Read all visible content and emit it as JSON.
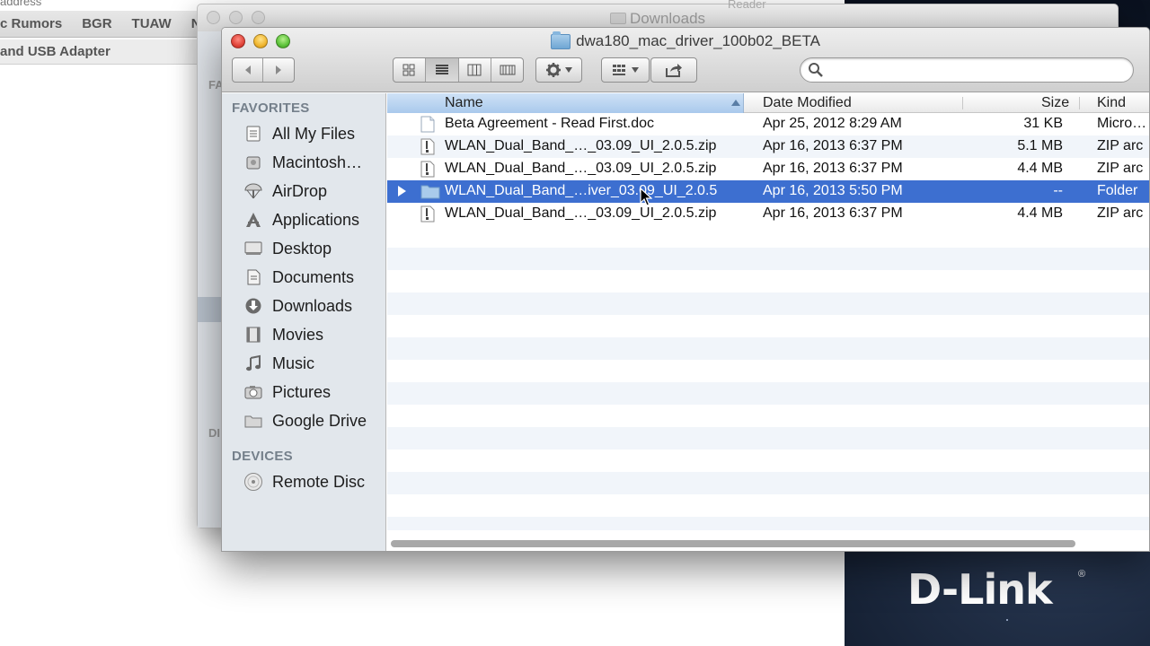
{
  "background_browser": {
    "address_fragment": "address",
    "bookmarks": [
      "c Rumors",
      "BGR",
      "TUAW",
      "N"
    ],
    "subtitle": "and USB Adapter",
    "strip_letters": [
      "FA",
      "DI"
    ]
  },
  "back_window": {
    "title": "Downloads",
    "behind_label": "Reader"
  },
  "window": {
    "title": "dwa180_mac_driver_100b02_BETA",
    "search": {
      "placeholder": "",
      "value": ""
    }
  },
  "toolbar": {
    "back_icon": "chevron-left-icon",
    "forward_icon": "chevron-right-icon",
    "view_modes": [
      "icon-view-icon",
      "list-view-icon",
      "column-view-icon",
      "coverflow-view-icon"
    ],
    "active_view": "list",
    "action_icon": "gear-icon",
    "arrange_icon": "grid-icon",
    "share_icon": "share-icon"
  },
  "sidebar": {
    "favorites_heading": "FAVORITES",
    "favorites": [
      {
        "label": "All My Files",
        "icon": "all-files-icon"
      },
      {
        "label": "Macintosh…",
        "icon": "hard-drive-icon"
      },
      {
        "label": "AirDrop",
        "icon": "airdrop-icon"
      },
      {
        "label": "Applications",
        "icon": "applications-icon"
      },
      {
        "label": "Desktop",
        "icon": "desktop-icon"
      },
      {
        "label": "Documents",
        "icon": "documents-icon"
      },
      {
        "label": "Downloads",
        "icon": "downloads-icon"
      },
      {
        "label": "Movies",
        "icon": "movies-icon"
      },
      {
        "label": "Music",
        "icon": "music-icon"
      },
      {
        "label": "Pictures",
        "icon": "pictures-icon"
      },
      {
        "label": "Google Drive",
        "icon": "folder-icon"
      }
    ],
    "devices_heading": "DEVICES",
    "devices": [
      {
        "label": "Remote Disc",
        "icon": "remote-disc-icon"
      }
    ]
  },
  "columns": {
    "name": "Name",
    "date": "Date Modified",
    "size": "Size",
    "kind": "Kind"
  },
  "files": [
    {
      "name": "Beta Agreement - Read First.doc",
      "date": "Apr 25, 2012 8:29 AM",
      "size": "31 KB",
      "kind": "Micro…",
      "icon": "document-icon",
      "selected": false
    },
    {
      "name": "WLAN_Dual_Band_…_03.09_UI_2.0.5.zip",
      "date": "Apr 16, 2013 6:37 PM",
      "size": "5.1 MB",
      "kind": "ZIP arc",
      "icon": "zip-icon",
      "selected": false
    },
    {
      "name": "WLAN_Dual_Band_…_03.09_UI_2.0.5.zip",
      "date": "Apr 16, 2013 6:37 PM",
      "size": "4.4 MB",
      "kind": "ZIP arc",
      "icon": "zip-icon",
      "selected": false
    },
    {
      "name": "WLAN_Dual_Band_…iver_03.09_UI_2.0.5",
      "date": "Apr 16, 2013 5:50 PM",
      "size": "--",
      "kind": "Folder",
      "icon": "folder-icon",
      "selected": true
    },
    {
      "name": "WLAN_Dual_Band_…_03.09_UI_2.0.5.zip",
      "date": "Apr 16, 2013 6:37 PM",
      "size": "4.4 MB",
      "kind": "ZIP arc",
      "icon": "zip-icon",
      "selected": false
    }
  ],
  "branding": {
    "logo_text": "D-Link",
    "registered": "®"
  },
  "colors": {
    "selection": "#3d6fd0",
    "sidebar_bg": "#e2e7ec",
    "row_alt": "#f1f5fa"
  }
}
